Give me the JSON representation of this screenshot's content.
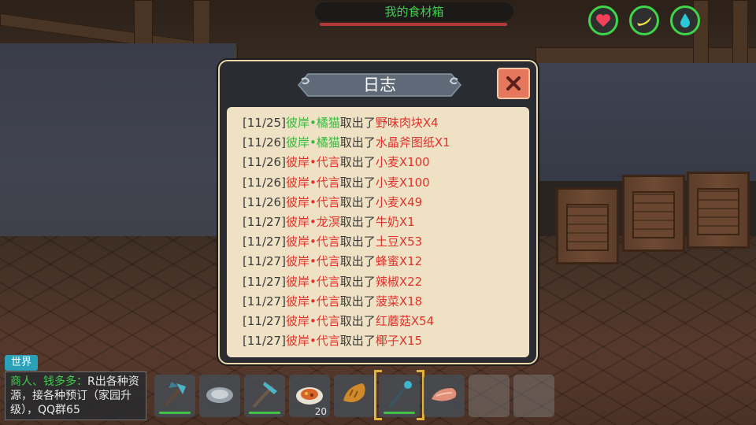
{
  "top": {
    "container_title": "我的食材箱"
  },
  "status_icons": [
    {
      "name": "health",
      "icon": "heart-icon",
      "color": "#f0405a"
    },
    {
      "name": "hunger",
      "icon": "banana-icon",
      "color": "#f2e24a"
    },
    {
      "name": "thirst",
      "icon": "water-drop-icon",
      "color": "#28c8d8"
    }
  ],
  "dialog": {
    "title": "日志",
    "close_icon": "close-icon",
    "log": [
      {
        "date": "[11/25]",
        "user": "彼岸•橘猫",
        "user_color": "green",
        "action": "取出了",
        "item": "野味肉块X4"
      },
      {
        "date": "[11/26]",
        "user": "彼岸•橘猫",
        "user_color": "green",
        "action": "取出了",
        "item": "水晶斧图纸X1"
      },
      {
        "date": "[11/26]",
        "user": "彼岸•代言",
        "user_color": "red",
        "action": "取出了",
        "item": "小麦X100"
      },
      {
        "date": "[11/26]",
        "user": "彼岸•代言",
        "user_color": "red",
        "action": "取出了",
        "item": "小麦X100"
      },
      {
        "date": "[11/26]",
        "user": "彼岸•代言",
        "user_color": "red",
        "action": "取出了",
        "item": "小麦X49"
      },
      {
        "date": "[11/27]",
        "user": "彼岸•龙溟",
        "user_color": "red",
        "action": "取出了",
        "item": "牛奶X1"
      },
      {
        "date": "[11/27]",
        "user": "彼岸•代言",
        "user_color": "red",
        "action": "取出了",
        "item": "土豆X53"
      },
      {
        "date": "[11/27]",
        "user": "彼岸•代言",
        "user_color": "red",
        "action": "取出了",
        "item": "蜂蜜X12"
      },
      {
        "date": "[11/27]",
        "user": "彼岸•代言",
        "user_color": "red",
        "action": "取出了",
        "item": "辣椒X22"
      },
      {
        "date": "[11/27]",
        "user": "彼岸•代言",
        "user_color": "red",
        "action": "取出了",
        "item": "菠菜X18"
      },
      {
        "date": "[11/27]",
        "user": "彼岸•代言",
        "user_color": "red",
        "action": "取出了",
        "item": "红蘑菇X54"
      },
      {
        "date": "[11/27]",
        "user": "彼岸•代言",
        "user_color": "red",
        "action": "取出了",
        "item": "椰子X15"
      }
    ]
  },
  "chat": {
    "channel": "世界",
    "sender": "商人、钱多多：",
    "message": "R出各种资源，接各种预订（家园升级），QQ群65"
  },
  "hotbar": [
    {
      "icon": "crystal-axe-icon",
      "count": "",
      "durability": 1
    },
    {
      "icon": "plate-icon",
      "count": "",
      "durability": 0
    },
    {
      "icon": "crystal-pickaxe-icon",
      "count": "",
      "durability": 1
    },
    {
      "icon": "food-dish-icon",
      "count": "20",
      "durability": 0
    },
    {
      "icon": "bread-icon",
      "count": "",
      "durability": 0
    },
    {
      "icon": "crystal-staff-icon",
      "count": "",
      "durability": 1,
      "selected": true
    },
    {
      "icon": "raw-meat-icon",
      "count": "",
      "durability": 0
    },
    {
      "icon": "empty-slot",
      "count": "",
      "durability": 0
    },
    {
      "icon": "empty-slot",
      "count": "",
      "durability": 0
    }
  ]
}
